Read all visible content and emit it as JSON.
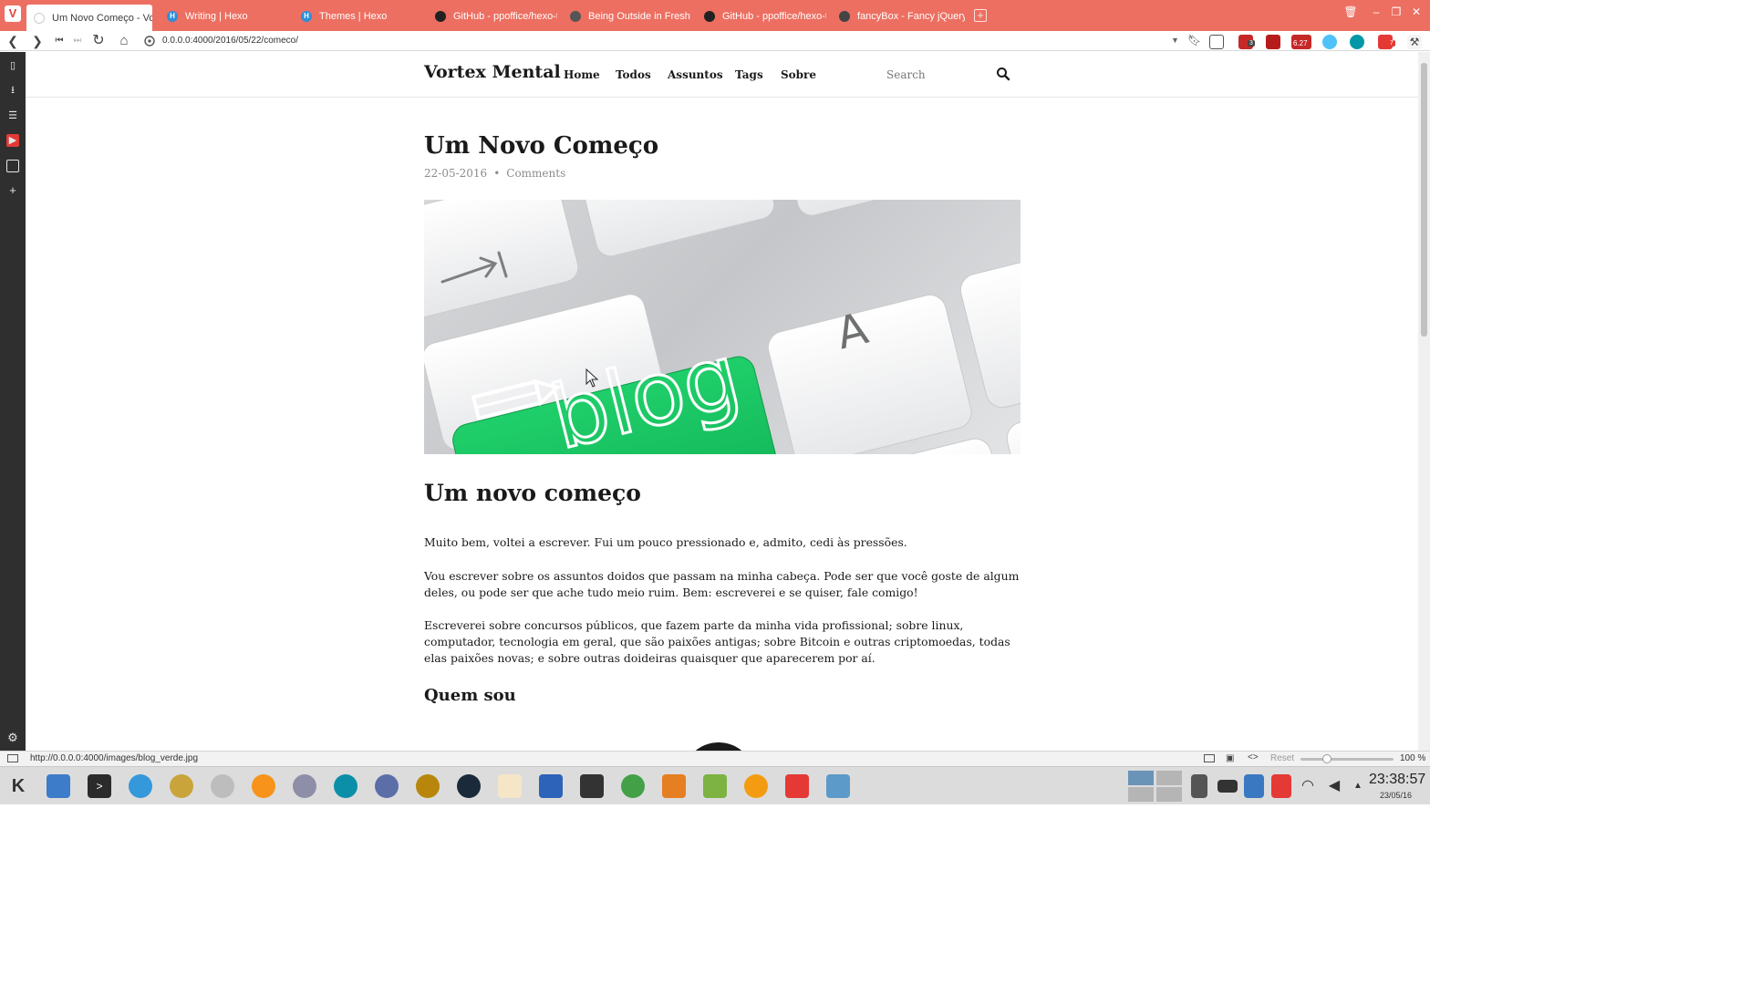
{
  "browser": {
    "tabs": [
      {
        "label": "Um Novo Começo - Vortex",
        "favicon": "blank-page-icon"
      },
      {
        "label": "Writing | Hexo",
        "favicon": "hexo-icon"
      },
      {
        "label": "Themes | Hexo",
        "favicon": "hexo-icon"
      },
      {
        "label": "GitHub - ppoffice/hexo-the",
        "favicon": "github-icon"
      },
      {
        "label": "Being Outside in Fresh Ai",
        "favicon": "globe-icon"
      },
      {
        "label": "GitHub - ppoffice/hexo-the",
        "favicon": "github-icon"
      },
      {
        "label": "fancyBox - Fancy jQuery L",
        "favicon": "fancybox-icon"
      }
    ],
    "url": "0.0.0.0:4000/2016/05/22/comeco/",
    "extension_badges": [
      "3",
      "6.27",
      "7"
    ],
    "status_url": "http://0.0.0.0:4000/images/blog_verde.jpg",
    "zoom_reset_label": "Reset",
    "zoom_value": "100 %",
    "zoom_level": 1.0,
    "accent_color": "#ed6f61"
  },
  "site": {
    "title": "Vortex Mental",
    "nav": [
      "Home",
      "Todos",
      "Assuntos",
      "Tags",
      "Sobre"
    ],
    "search_placeholder": "Search"
  },
  "post": {
    "title": "Um Novo Começo",
    "date": "22-05-2016",
    "comments_label": "Comments",
    "hero_image_text": "blog",
    "hero_key_letter": "A",
    "heading": "Um novo começo",
    "paragraphs": [
      "Muito bem, voltei a escrever. Fui um pouco pressionado e, admito, cedi às pressões.",
      "Vou escrever sobre os assuntos doidos que passam na minha cabeça. Pode ser que você goste de algum deles, ou pode ser que ache tudo meio ruim. Bem: escreverei e se quiser, fale comigo!",
      "Escreverei sobre concursos públicos, que fazem parte da minha vida profissional; sobre linux, computador, tecnologia em geral, que são paixões antigas; sobre Bitcoin e outras criptomoedas, todas elas paixões novas; e sobre outras doideiras quaisquer que aparecerem por aí."
    ],
    "subheading": "Quem sou"
  },
  "taskbar": {
    "time": "23:38:57",
    "date": "23/05/16"
  }
}
